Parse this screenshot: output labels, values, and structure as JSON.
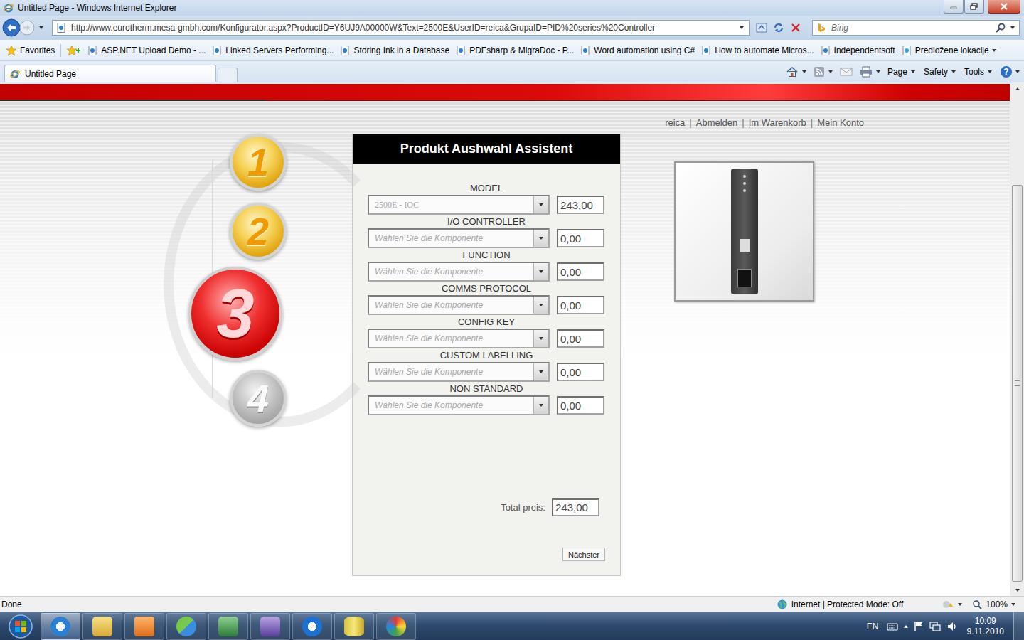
{
  "window": {
    "title": "Untitled Page - Windows Internet Explorer"
  },
  "address_bar": {
    "url": "http://www.eurotherm.mesa-gmbh.com/Konfigurator.aspx?ProductID=Y6UJ9A00000W&Text=2500E&UserID=reica&GrupaID=PID%20series%20Controller",
    "search_placeholder": "Bing"
  },
  "favorites_bar": {
    "label": "Favorites",
    "items": [
      {
        "label": "ASP.NET Upload Demo - ...",
        "folder": false
      },
      {
        "label": "Linked Servers Performing...",
        "folder": false
      },
      {
        "label": "Storing Ink in a Database",
        "folder": false
      },
      {
        "label": "PDFsharp & MigraDoc - P...",
        "folder": false
      },
      {
        "label": "Word automation using C#",
        "folder": false
      },
      {
        "label": "How to automate Micros...",
        "folder": false
      },
      {
        "label": "Independentsoft",
        "folder": false
      },
      {
        "label": "Predložene lokacije",
        "folder": true
      }
    ]
  },
  "tabs": [
    {
      "label": "Untitled Page",
      "selected": true
    }
  ],
  "command_bar": {
    "menus": [
      "Page",
      "Safety",
      "Tools"
    ],
    "help_icon": "?"
  },
  "page": {
    "user": "reica",
    "separator": "|",
    "links": [
      "Abmelden",
      "Im Warenkorb",
      "Mein Konto"
    ],
    "steps": [
      {
        "label": "1",
        "done": true,
        "selected": false
      },
      {
        "label": "2",
        "done": true,
        "selected": false
      },
      {
        "label": "3",
        "done": false,
        "selected": true
      },
      {
        "label": "4",
        "done": false,
        "selected": false
      }
    ],
    "panel": {
      "title": "Produkt Aushwahl Assistent",
      "fields": [
        {
          "label": "MODEL",
          "text": "2500E - IOC",
          "is_placeholder": false,
          "disabled": true,
          "price": "243,00"
        },
        {
          "label": "I/O CONTROLLER",
          "text": "Wählen Sie die Komponente",
          "is_placeholder": true,
          "disabled": true,
          "price": "0,00"
        },
        {
          "label": "FUNCTION",
          "text": "Wählen Sie die Komponente",
          "is_placeholder": true,
          "disabled": true,
          "price": "0,00"
        },
        {
          "label": "COMMS PROTOCOL",
          "text": "Wählen Sie die Komponente",
          "is_placeholder": true,
          "disabled": true,
          "price": "0,00"
        },
        {
          "label": "CONFIG KEY",
          "text": "Wählen Sie die Komponente",
          "is_placeholder": true,
          "disabled": true,
          "price": "0,00"
        },
        {
          "label": "CUSTOM LABELLING",
          "text": "Wählen Sie die Komponente",
          "is_placeholder": true,
          "disabled": true,
          "price": "0,00"
        },
        {
          "label": "NON STANDARD",
          "text": "Wählen Sie die Komponente",
          "is_placeholder": true,
          "disabled": true,
          "price": "0,00"
        }
      ],
      "total_label": "Total preis:",
      "total": "243,00",
      "next_button": "Nächster"
    }
  },
  "status_bar": {
    "text": "Done",
    "zone": "Internet | Protected Mode: Off",
    "zoom": "100%"
  },
  "taskbar": {
    "language": "EN",
    "time": "10:09",
    "date": "9.11.2010"
  }
}
